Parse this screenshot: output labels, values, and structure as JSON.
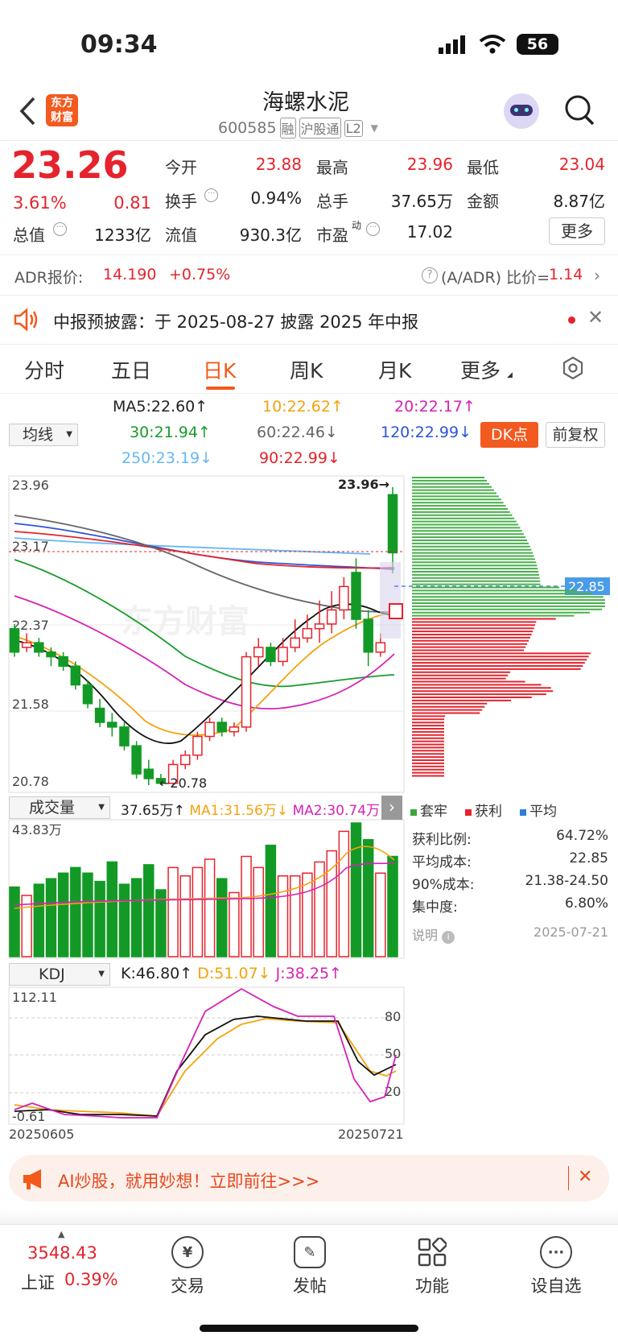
{
  "status": {
    "time": "09:34",
    "battery": "56"
  },
  "header": {
    "logo": "东方财富",
    "title": "海螺水泥",
    "code": "600585",
    "tags": [
      "融",
      "沪股通",
      "L2"
    ]
  },
  "quote": {
    "price": "23.26",
    "pct": "3.61%",
    "chg": "0.81",
    "rows": [
      [
        {
          "k": "今开",
          "v": "23.88",
          "c": "red"
        },
        {
          "k": "最高",
          "v": "23.96",
          "c": "red"
        },
        {
          "k": "最低",
          "v": "23.04",
          "c": "red"
        }
      ],
      [
        {
          "k": "换手",
          "v": "0.94%",
          "c": "dark"
        },
        {
          "k": "总手",
          "v": "37.65万",
          "c": "dark"
        },
        {
          "k": "金额",
          "v": "8.87亿",
          "c": "dark"
        }
      ],
      [
        {
          "k": "总值",
          "v": "1233亿",
          "c": "dark"
        },
        {
          "k": "流值",
          "v": "930.3亿",
          "c": "dark"
        },
        {
          "k": "市盈",
          "v": "17.02",
          "c": "dark"
        }
      ]
    ],
    "more": "更多"
  },
  "adr": {
    "label": "ADR报价:",
    "price": "14.190",
    "pct": "+0.75%",
    "ratio_label": "(A/ADR) 比价=",
    "ratio": "1.14"
  },
  "notice": {
    "text": "中报预披露：于 2025-08-27 披露 2025 年中报"
  },
  "tabs": [
    "分时",
    "五日",
    "日K",
    "周K",
    "月K",
    "更多"
  ],
  "ma": {
    "selector": "均线",
    "items": [
      {
        "t": "MA5:22.60",
        "a": "↑",
        "c": "#222"
      },
      {
        "t": "10:22.62",
        "a": "↑",
        "c": "#f2a30f"
      },
      {
        "t": "20:22.17",
        "a": "↑",
        "c": "#d622b5"
      },
      {
        "t": "30:21.94",
        "a": "↑",
        "c": "#1a9c2c"
      },
      {
        "t": "60:22.46",
        "a": "↓",
        "c": "#666"
      },
      {
        "t": "120:22.99",
        "a": "↓",
        "c": "#2d54d8"
      },
      {
        "t": "250:23.19",
        "a": "↓",
        "c": "#66b8f2"
      },
      {
        "t": "90:22.99",
        "a": "↓",
        "c": "#e5232d"
      }
    ],
    "dk": "DK点",
    "fq": "前复权"
  },
  "kline": {
    "y_labels": [
      "23.96",
      "23.17",
      "22.37",
      "21.58",
      "20.78"
    ],
    "high_mark": "23.96",
    "low_mark": "20.78",
    "avg_cost": "22.85",
    "watermark": "东方财富"
  },
  "chart_data": {
    "type": "candlestick",
    "x_range": [
      "20250605",
      "20250721"
    ],
    "ylim": [
      20.78,
      23.96
    ],
    "candles": [
      [
        22.45,
        22.2,
        22.5,
        22.15
      ],
      [
        22.25,
        22.3,
        22.4,
        22.2
      ],
      [
        22.3,
        22.2,
        22.35,
        22.15
      ],
      [
        22.2,
        22.15,
        22.25,
        22.05
      ],
      [
        22.15,
        22.05,
        22.2,
        22.0
      ],
      [
        22.05,
        21.85,
        22.1,
        21.8
      ],
      [
        21.85,
        21.65,
        21.9,
        21.6
      ],
      [
        21.6,
        21.45,
        21.7,
        21.4
      ],
      [
        21.45,
        21.4,
        21.55,
        21.3
      ],
      [
        21.4,
        21.2,
        21.45,
        21.15
      ],
      [
        21.2,
        20.9,
        21.25,
        20.85
      ],
      [
        20.95,
        20.85,
        21.05,
        20.78
      ],
      [
        20.85,
        20.8,
        20.9,
        20.78
      ],
      [
        20.8,
        21.0,
        21.05,
        20.78
      ],
      [
        21.0,
        21.1,
        21.15,
        20.95
      ],
      [
        21.1,
        21.3,
        21.35,
        21.05
      ],
      [
        21.3,
        21.45,
        21.5,
        21.25
      ],
      [
        21.45,
        21.35,
        21.5,
        21.3
      ],
      [
        21.35,
        21.4,
        21.45,
        21.3
      ],
      [
        21.4,
        22.15,
        22.2,
        21.35
      ],
      [
        22.15,
        22.25,
        22.35,
        22.05
      ],
      [
        22.25,
        22.1,
        22.3,
        22.05
      ],
      [
        22.1,
        22.25,
        22.35,
        22.05
      ],
      [
        22.25,
        22.35,
        22.55,
        22.2
      ],
      [
        22.35,
        22.45,
        22.6,
        22.3
      ],
      [
        22.45,
        22.5,
        22.75,
        22.3
      ],
      [
        22.5,
        22.65,
        22.85,
        22.4
      ],
      [
        22.65,
        22.9,
        23.0,
        22.55
      ],
      [
        23.05,
        22.55,
        23.2,
        22.45
      ],
      [
        22.55,
        22.2,
        22.65,
        22.05
      ],
      [
        22.2,
        22.3,
        22.4,
        22.15
      ],
      [
        23.88,
        23.26,
        23.96,
        23.04
      ]
    ],
    "ma_series": [
      {
        "name": "MA5",
        "color": "#222"
      },
      {
        "name": "10",
        "color": "#f2a30f"
      },
      {
        "name": "20",
        "color": "#d622b5"
      },
      {
        "name": "30",
        "color": "#1a9c2c"
      },
      {
        "name": "60",
        "color": "#666"
      },
      {
        "name": "120",
        "color": "#2d54d8"
      },
      {
        "name": "250",
        "color": "#66b8f2"
      },
      {
        "name": "90",
        "color": "#e5232d"
      }
    ],
    "volume": {
      "max": "43.83万",
      "values": [
        25,
        22,
        26,
        28,
        30,
        32,
        30,
        27,
        34,
        26,
        28,
        33,
        24,
        32,
        29,
        32,
        35,
        28,
        23,
        36,
        32,
        40,
        29,
        29,
        30,
        34,
        38,
        45,
        48,
        42,
        30,
        36
      ]
    },
    "kdj": {
      "max": "112.11",
      "min": "-0.61",
      "levels": [
        "80",
        "50",
        "20"
      ]
    }
  },
  "volume_bar": {
    "selector": "成交量",
    "v": "37.65万",
    "v_arrow": "↑",
    "ma1": "MA1:31.56万",
    "ma1_arrow": "↓",
    "ma2": "MA2:30.74万"
  },
  "kdj_bar": {
    "selector": "KDJ",
    "k": "K:46.80",
    "k_arrow": "↑",
    "d": "D:51.07",
    "d_arrow": "↓",
    "j": "J:38.25",
    "j_arrow": "↑"
  },
  "dates": {
    "start": "20250605",
    "end": "20250721"
  },
  "chips": {
    "legend": [
      {
        "t": "套牢",
        "c": "#3aa63a"
      },
      {
        "t": "获利",
        "c": "#e5232d"
      },
      {
        "t": "平均",
        "c": "#2d7ed8"
      }
    ],
    "rows": [
      {
        "k": "获利比例:",
        "v": "64.72%"
      },
      {
        "k": "平均成本:",
        "v": "22.85"
      },
      {
        "k": "90%成本:",
        "v": "21.38-24.50"
      },
      {
        "k": "集中度:",
        "v": "6.80%"
      }
    ],
    "note": "说明",
    "date": "2025-07-21"
  },
  "ad": {
    "text": "AI炒股，就用妙想！立即前往>>>"
  },
  "bottom": {
    "index_value": "3548.43",
    "index_name": "上证",
    "index_pct": "0.39%",
    "nav": [
      "交易",
      "发帖",
      "功能",
      "设自选"
    ]
  }
}
